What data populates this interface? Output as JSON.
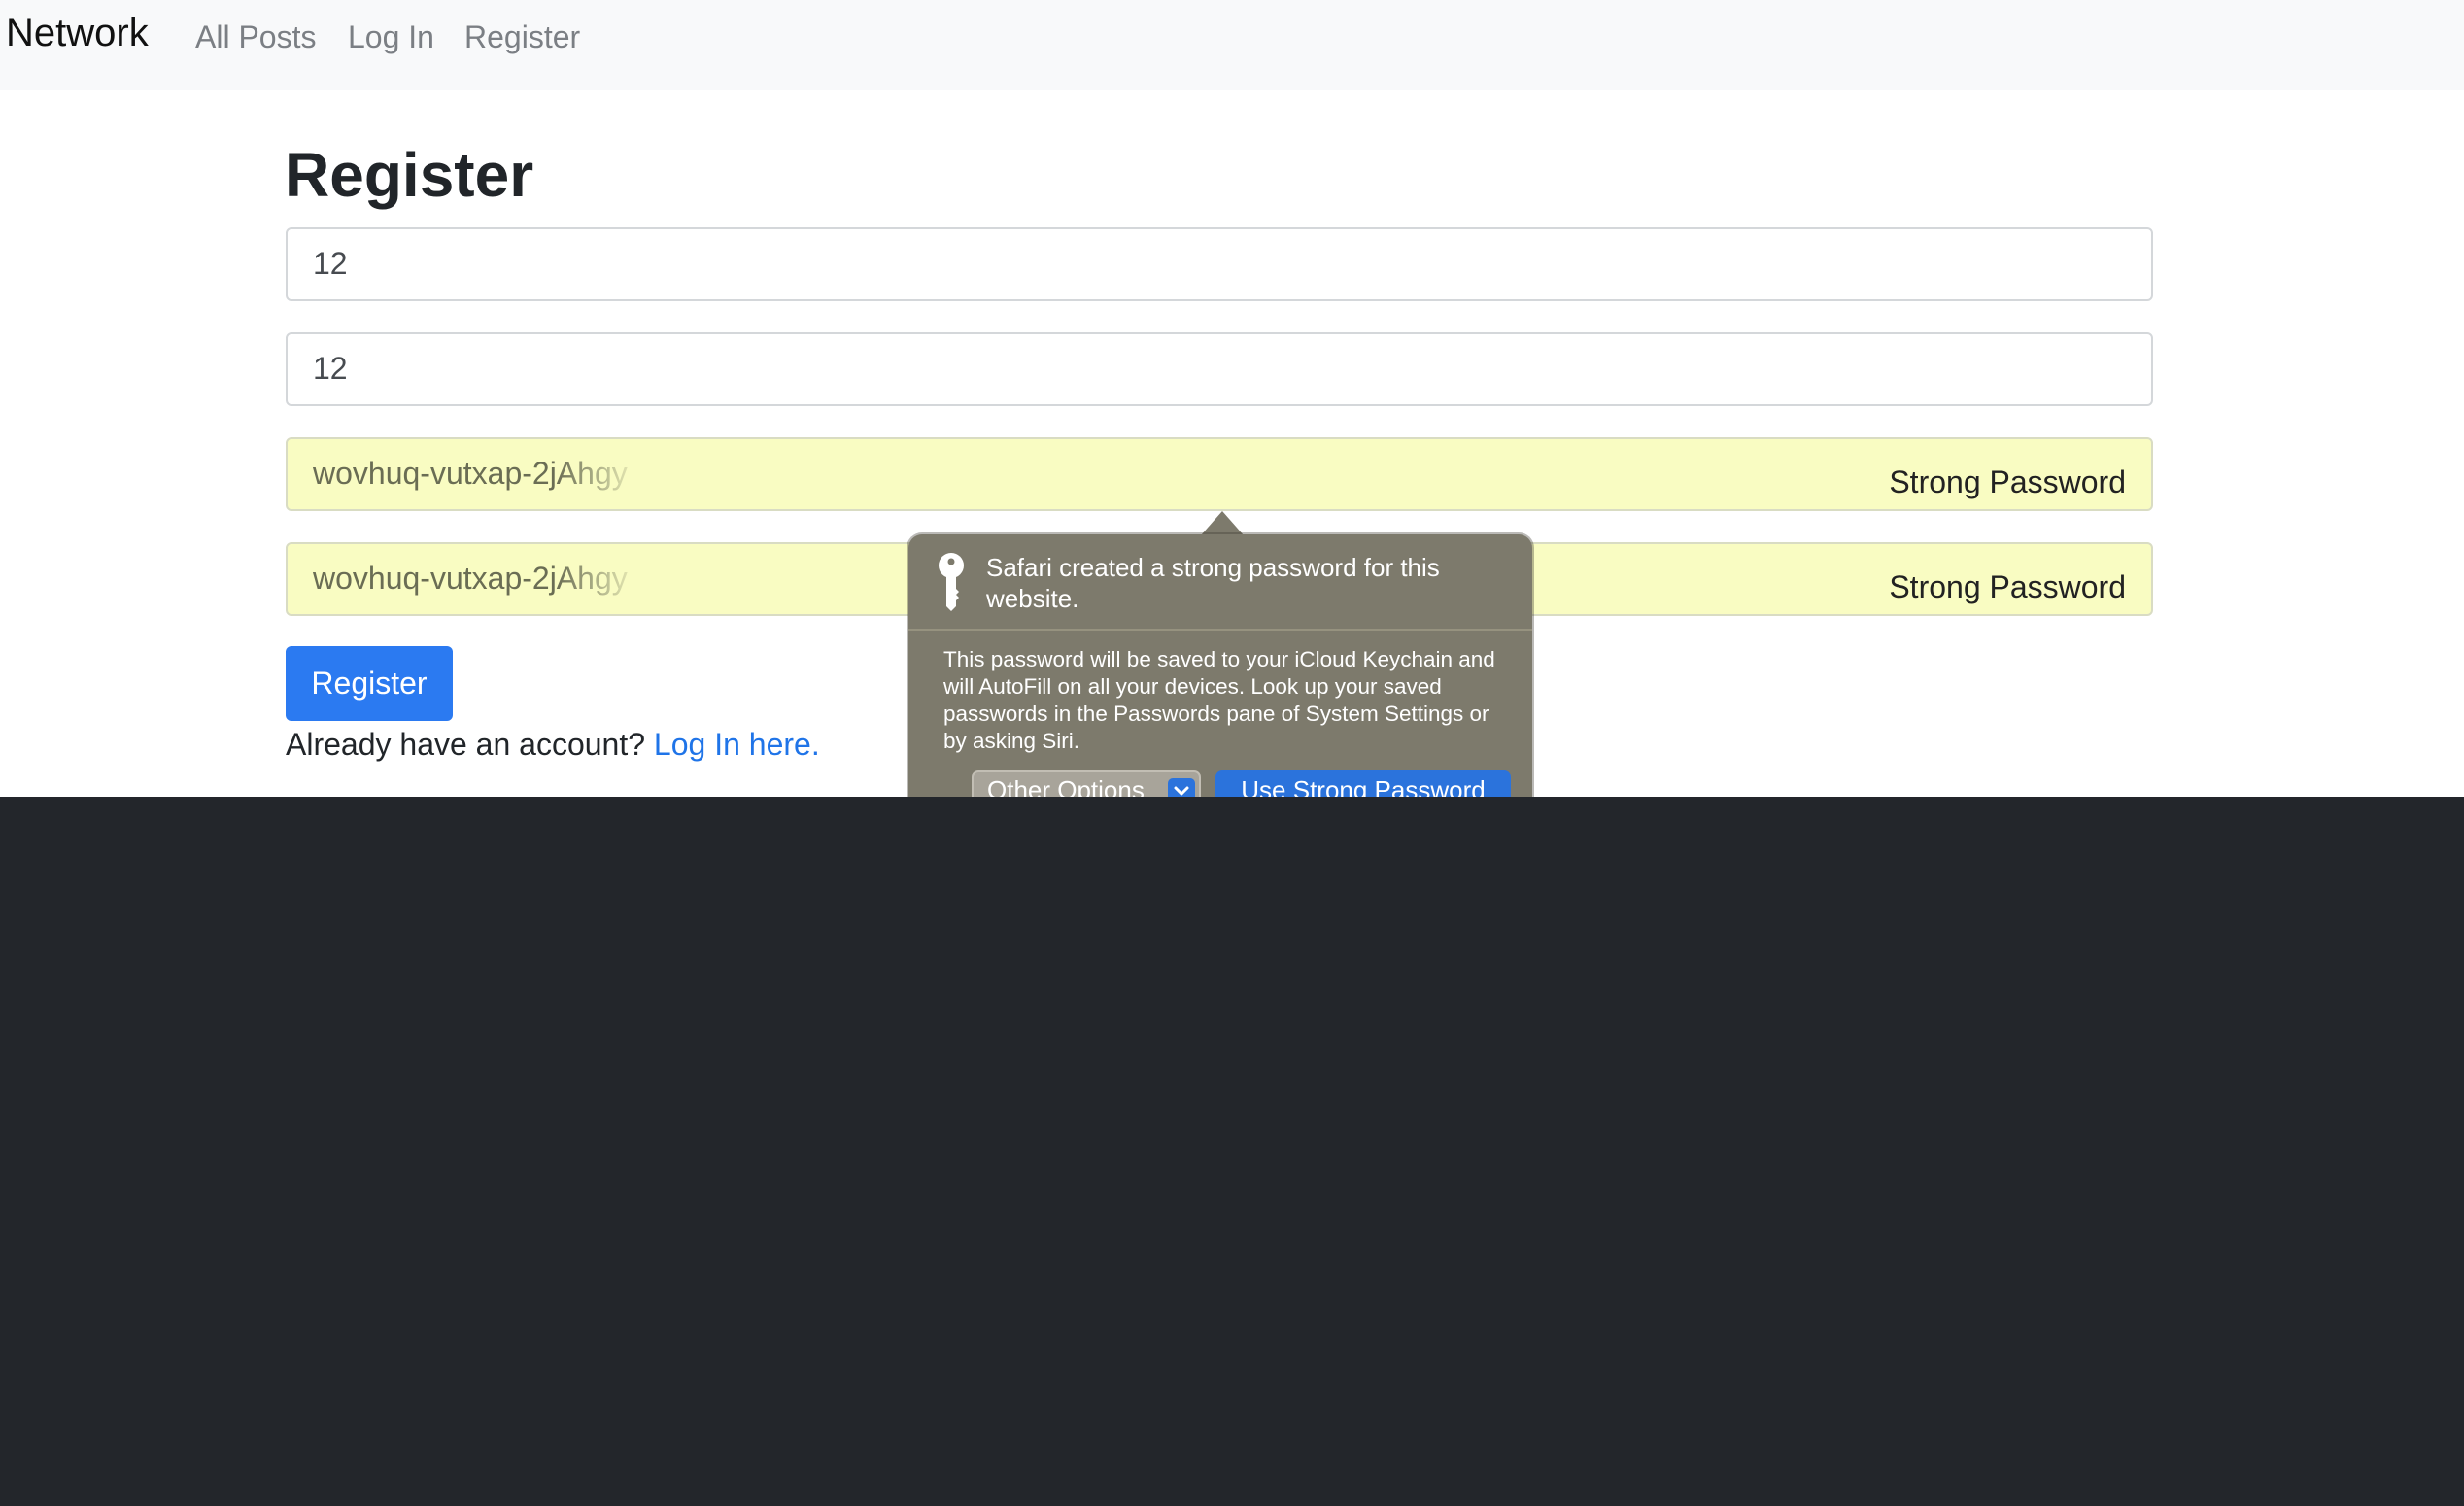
{
  "navbar": {
    "brand": "Network",
    "links": [
      "All Posts",
      "Log In",
      "Register"
    ]
  },
  "form": {
    "title": "Register",
    "username_value": "12",
    "email_value": "12",
    "password_value": "wovhuq-vutxap-2jAhgy",
    "confirmation_value": "wovhuq-vutxap-2jAhgy",
    "strong_password_label": "Strong Password",
    "submit_label": "Register",
    "login_prompt": "Already have an account?",
    "login_link": "Log In here."
  },
  "safari_popover": {
    "icon": "key-icon",
    "title": "Safari created a strong password for this website.",
    "body": "This password will be saved to your iCloud Keychain and will AutoFill on all your devices. Look up your saved passwords in the Passwords pane of System Settings or by asking Siri.",
    "other_options_label": "Other Options",
    "use_strong_password_label": "Use Strong Password"
  },
  "colors": {
    "navbar_bg": "#f8f9fa",
    "primary": "#2b7af1",
    "autofill_bg": "#f9fcc2",
    "popover_bg": "#7d7a6c",
    "footer_bg": "#23262b"
  }
}
